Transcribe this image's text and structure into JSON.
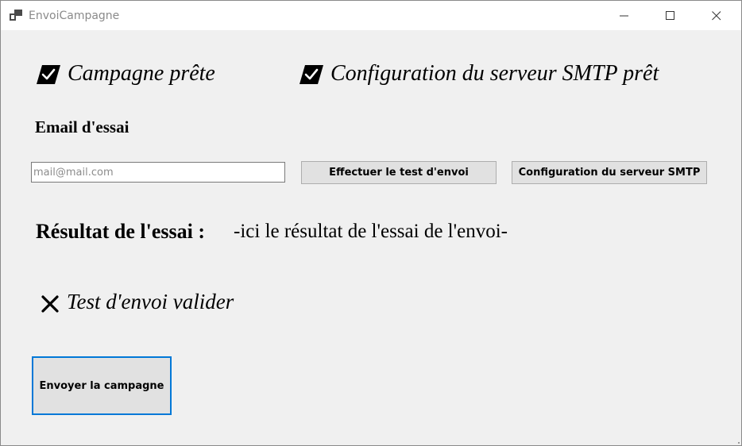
{
  "window": {
    "title": "EnvoiCampagne",
    "controls": {
      "minimize": "minimize",
      "maximize": "maximize",
      "close": "close"
    }
  },
  "status": {
    "campaign_ready": {
      "label": "Campagne prête",
      "checked": true
    },
    "smtp_ready": {
      "label": "Configuration du serveur SMTP prêt",
      "checked": true
    },
    "test_valid": {
      "label": "Test d'envoi valider",
      "state": "failed"
    }
  },
  "test_email": {
    "label": "Email d'essai",
    "value": "",
    "placeholder": "mail@mail.com"
  },
  "buttons": {
    "run_test": "Effectuer le test d'envoi",
    "smtp_config": "Configuration du serveur SMTP",
    "send_campaign": "Envoyer la campagne"
  },
  "result": {
    "label": "Résultat de l'essai :",
    "value": "-ici le résultat de l'essai de l'envoi-"
  },
  "colors": {
    "accent": "#0078d7",
    "background": "#f0f0f0",
    "button": "#e1e1e1"
  }
}
